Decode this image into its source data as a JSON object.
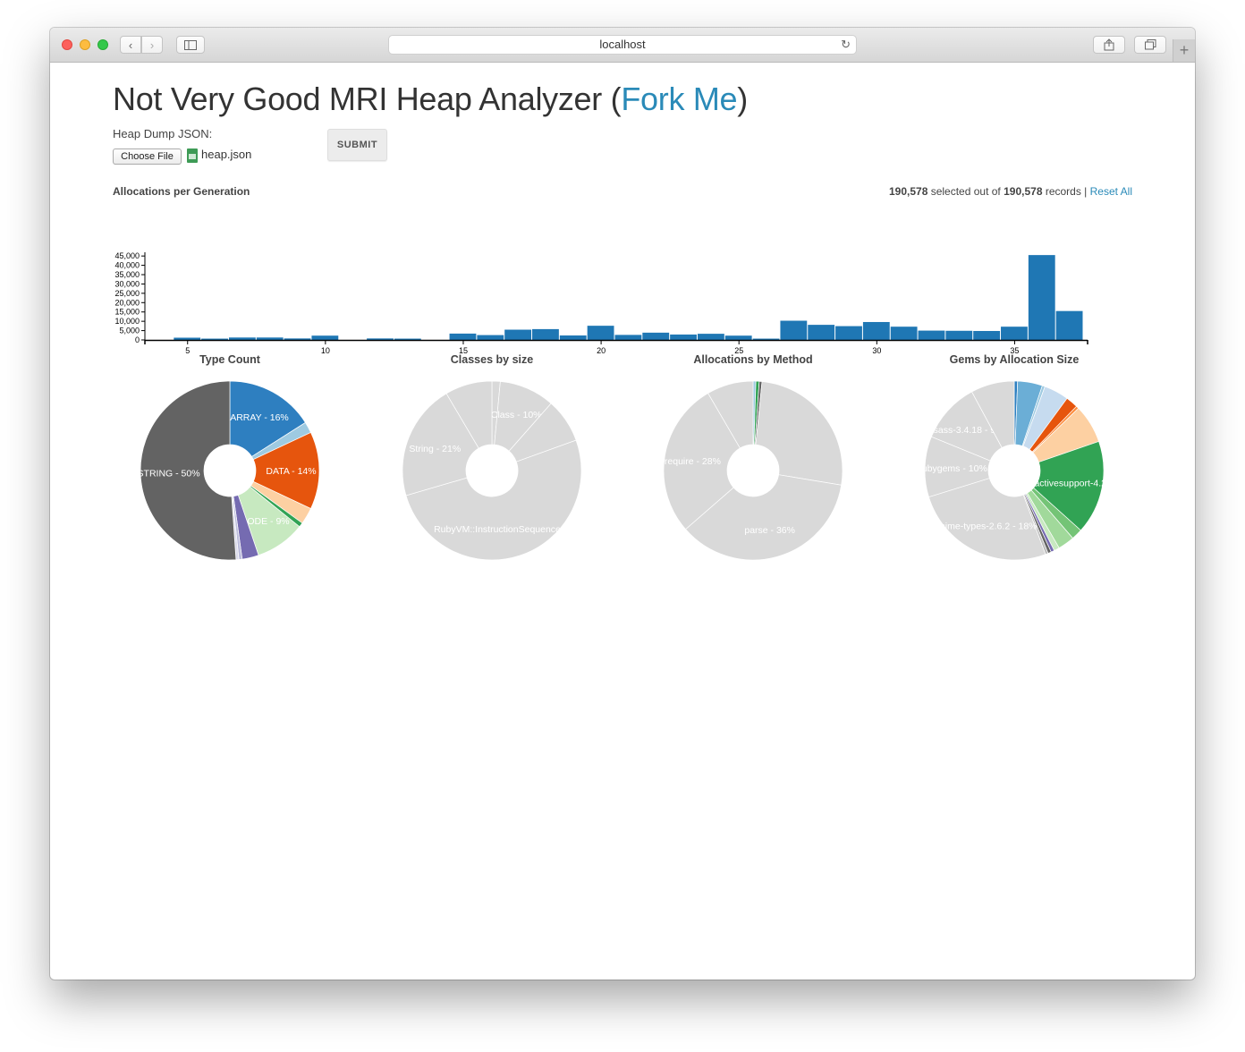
{
  "browser": {
    "url": "localhost",
    "colors": {
      "close": "#fc605c",
      "minimize": "#fdbc40",
      "zoom": "#34c84a"
    }
  },
  "page": {
    "title": "Not Very Good MRI Heap Analyzer (",
    "title_link": "Fork Me",
    "title_close": ")",
    "heap_label": "Heap Dump JSON:",
    "choose_file": "Choose File",
    "file_name": "heap.json",
    "submit": "SUBMIT",
    "histogram_title": "Allocations per Generation",
    "selected_count": "190,578",
    "selected_text": " selected out of ",
    "total_count": "190,578",
    "records_text": " records | ",
    "reset_all": "Reset All",
    "accent": "#2a8ab8"
  },
  "chart_data": [
    {
      "type": "bar",
      "title": "Allocations per Generation",
      "x": [
        4,
        5,
        6,
        7,
        8,
        9,
        10,
        11,
        12,
        13,
        14,
        15,
        16,
        17,
        18,
        19,
        20,
        21,
        22,
        23,
        24,
        25,
        26,
        27,
        28,
        29,
        30,
        31,
        32,
        33,
        34,
        35,
        36,
        37
      ],
      "values": [
        0,
        1200,
        700,
        1300,
        1300,
        800,
        2300,
        0,
        800,
        700,
        0,
        3400,
        2600,
        5500,
        5800,
        2400,
        7600,
        2700,
        3900,
        2900,
        3300,
        2300,
        700,
        10300,
        8100,
        7400,
        9600,
        7100,
        5000,
        4900,
        4800,
        7100,
        45500,
        15500
      ],
      "xticks": [
        5,
        10,
        15,
        20,
        25,
        30,
        35
      ],
      "yticks": [
        "0",
        "5,000",
        "10,000",
        "15,000",
        "20,000",
        "25,000",
        "30,000",
        "35,000",
        "40,000",
        "45,000"
      ],
      "ylim": [
        0,
        47000
      ],
      "color": "#1f77b4"
    },
    {
      "type": "pie",
      "title": "Type Count",
      "slices": [
        {
          "label": "ARRAY - 16%",
          "value": 16,
          "color": "#2e7fc0"
        },
        {
          "label": "",
          "value": 2,
          "color": "#9ecae1"
        },
        {
          "label": "DATA - 14%",
          "value": 14,
          "color": "#e6550d"
        },
        {
          "label": "",
          "value": 3,
          "color": "#fdd0a2"
        },
        {
          "label": "",
          "value": 0.8,
          "color": "#31a354"
        },
        {
          "label": "NODE - 9%",
          "value": 9,
          "color": "#c7e9c0"
        },
        {
          "label": "",
          "value": 3,
          "color": "#756bb1"
        },
        {
          "label": "",
          "value": 0.6,
          "color": "#bcbddc"
        },
        {
          "label": "",
          "value": 0.5,
          "color": "#dadaeb"
        },
        {
          "label": "STRING - 50%",
          "value": 51.1,
          "color": "#636363"
        }
      ]
    },
    {
      "type": "pie",
      "title": "Classes by size",
      "slices": [
        {
          "label": "",
          "value": 1.5,
          "color": "#d9d9d9"
        },
        {
          "label": "Class - 10%",
          "value": 10,
          "color": "#d9d9d9"
        },
        {
          "label": "",
          "value": 8,
          "color": "#d9d9d9"
        },
        {
          "label": "RubyVM::InstructionSequence - 51%",
          "value": 51,
          "color": "#d9d9d9"
        },
        {
          "label": "String - 21%",
          "value": 21,
          "color": "#d9d9d9"
        },
        {
          "label": "",
          "value": 8.5,
          "color": "#d9d9d9"
        }
      ]
    },
    {
      "type": "pie",
      "title": "Allocations by Method",
      "slices": [
        {
          "label": "",
          "value": 0.5,
          "color": "#9ecae1"
        },
        {
          "label": "",
          "value": 0.6,
          "color": "#31a354"
        },
        {
          "label": "",
          "value": 0.5,
          "color": "#636363"
        },
        {
          "label": "",
          "value": 26,
          "color": "#d9d9d9"
        },
        {
          "label": "parse - 36%",
          "value": 36,
          "color": "#d9d9d9"
        },
        {
          "label": "require - 28%",
          "value": 28,
          "color": "#d9d9d9"
        },
        {
          "label": "",
          "value": 8.4,
          "color": "#d9d9d9"
        }
      ]
    },
    {
      "type": "pie",
      "title": "Gems by Allocation Size",
      "slices": [
        {
          "label": "",
          "value": 0.6,
          "color": "#2e7fc0"
        },
        {
          "label": "",
          "value": 4.5,
          "color": "#6baed6"
        },
        {
          "label": "",
          "value": 0.5,
          "color": "#9ecae1"
        },
        {
          "label": "",
          "value": 4.5,
          "color": "#c6dbef"
        },
        {
          "label": "",
          "value": 2.2,
          "color": "#e6550d"
        },
        {
          "label": "",
          "value": 0.5,
          "color": "#fd8d3c"
        },
        {
          "label": "",
          "value": 7,
          "color": "#fdd0a2"
        },
        {
          "label": "activesupport-4.2.0",
          "value": 17,
          "color": "#31a354"
        },
        {
          "label": "",
          "value": 2,
          "color": "#74c476"
        },
        {
          "label": "",
          "value": 3,
          "color": "#a1d99b"
        },
        {
          "label": "",
          "value": 1,
          "color": "#c7e9c0"
        },
        {
          "label": "",
          "value": 0.6,
          "color": "#756bb1"
        },
        {
          "label": "",
          "value": 0.6,
          "color": "#636363"
        },
        {
          "label": "",
          "value": 0.5,
          "color": "#bdbdbd"
        },
        {
          "label": "mime-types-2.6.2 - 18%",
          "value": 26,
          "color": "#d9d9d9"
        },
        {
          "label": "rubygems - 10%",
          "value": 11,
          "color": "#d9d9d9"
        },
        {
          "label": "sass-3.4.18 - 9%",
          "value": 11,
          "color": "#d9d9d9"
        },
        {
          "label": "",
          "value": 7.9,
          "color": "#d9d9d9"
        }
      ]
    }
  ]
}
